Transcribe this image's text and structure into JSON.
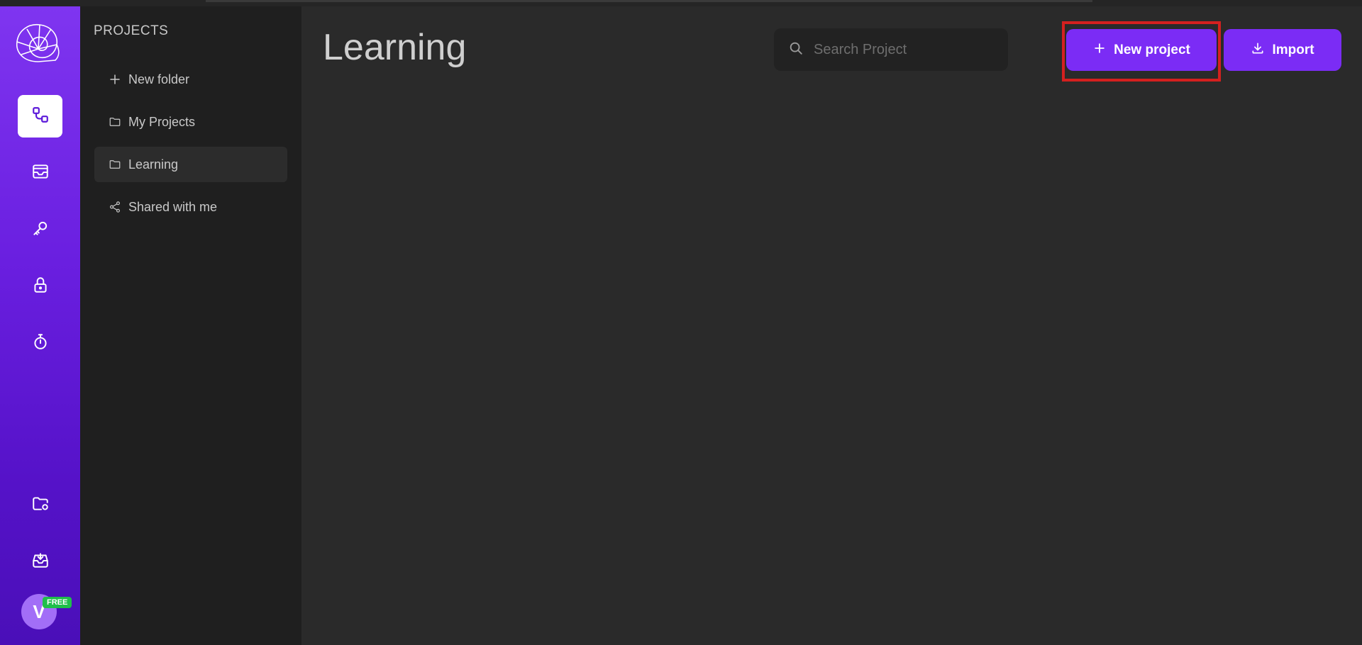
{
  "rail": {
    "logo_icon": "nautilus-shell-icon",
    "items": [
      {
        "icon": "flow-nodes-icon",
        "active": true
      },
      {
        "icon": "inbox-icon",
        "active": false
      },
      {
        "icon": "key-icon",
        "active": false
      },
      {
        "icon": "lock-icon",
        "active": false
      },
      {
        "icon": "timer-icon",
        "active": false
      }
    ],
    "bottom_items": [
      {
        "icon": "folder-settings-icon"
      },
      {
        "icon": "download-tray-icon"
      }
    ],
    "avatar_initial": "V",
    "plan_badge": "FREE"
  },
  "panel": {
    "title": "PROJECTS",
    "items": [
      {
        "label": "New folder",
        "icon": "plus-icon"
      },
      {
        "label": "My Projects",
        "icon": "folder-icon"
      },
      {
        "label": "Learning",
        "icon": "folder-icon",
        "selected": true
      },
      {
        "label": "Shared with me",
        "icon": "share-icon"
      }
    ]
  },
  "main": {
    "title": "Learning",
    "search": {
      "placeholder": "Search Project",
      "value": ""
    },
    "new_project_label": "New project",
    "import_label": "Import"
  },
  "colors": {
    "accent": "#7b2cf5",
    "rail_top": "#7f35f0",
    "rail_bottom": "#4a0fb8",
    "highlight": "#d4201f",
    "badge": "#1fbf4a"
  }
}
